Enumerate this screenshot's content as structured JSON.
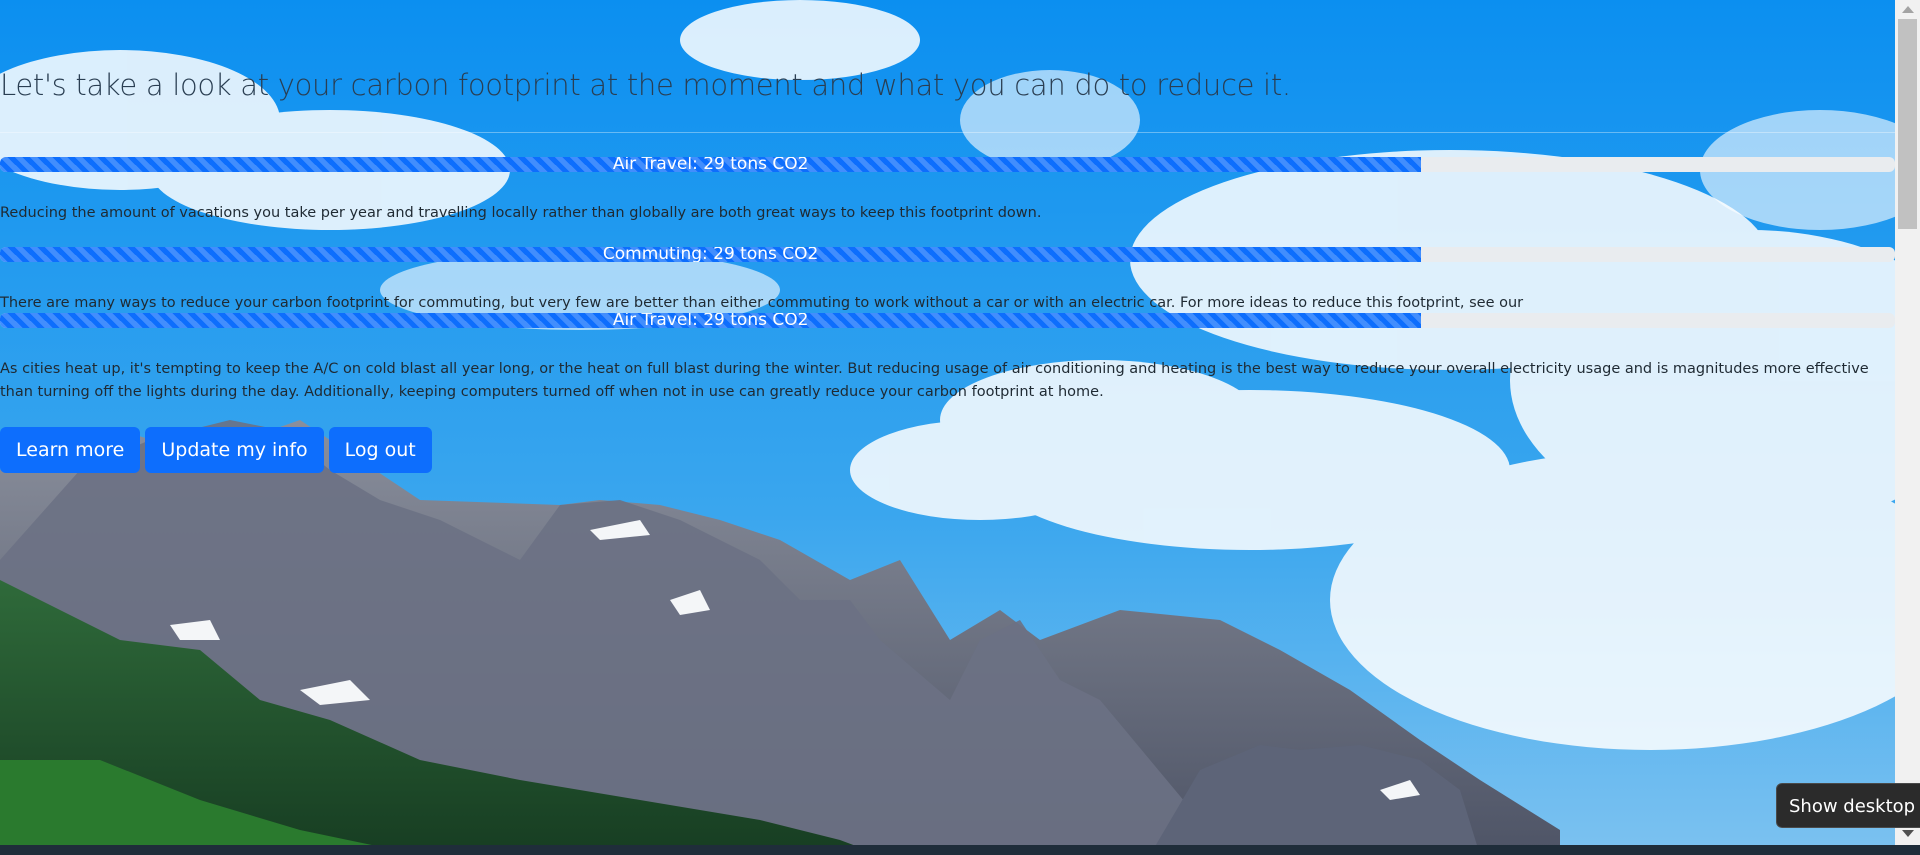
{
  "header": {
    "headline": "Let's take a look at your carbon footprint at the moment and what you can do to reduce it."
  },
  "footprints": [
    {
      "label": "Air Travel: 29 tons CO2",
      "progress_percent": 75,
      "tip": "Reducing the amount of vacations you take per year and travelling locally rather than globally are both great ways to keep this footprint down."
    },
    {
      "label": "Commuting: 29 tons CO2",
      "progress_percent": 75,
      "tip": "There are many ways to reduce your carbon footprint for commuting, but very few are better than either commuting to work without a car or with an electric car. For more ideas to reduce this footprint, see our"
    },
    {
      "label": "Air Travel: 29 tons CO2",
      "progress_percent": 75,
      "tip": "As cities heat up, it's tempting to keep the A/C on cold blast all year long, or the heat on full blast during the winter. But reducing usage of air conditioning and heating is the best way to reduce your overall electricity usage and is magnitudes more effective than turning off the lights during the day. Additionally, keeping computers turned off when not in use can greatly reduce your carbon footprint at home."
    }
  ],
  "actions": {
    "learn_more": "Learn more",
    "update_info": "Update my info",
    "log_out": "Log out"
  },
  "system": {
    "show_desktop": "Show desktop"
  },
  "colors": {
    "accent": "#0d6efd",
    "progress_track": "#e9ecef",
    "sky": "#1a8fe6"
  }
}
